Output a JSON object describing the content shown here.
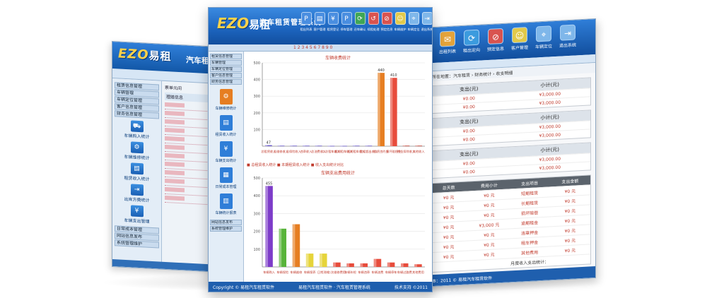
{
  "left_window": {
    "logo": "EZO",
    "logo_cn": "易租",
    "title": "汽车租赁",
    "menu": [
      "租赁信息管理",
      "车辆管理",
      "车辆定位管理",
      "客户信息管理",
      "财务信息管理"
    ],
    "icons": [
      {
        "name": "car-in-icon",
        "glyph": "⛟",
        "label": "车辆购入统计"
      },
      {
        "name": "repair-icon",
        "glyph": "⚙",
        "label": "车辆维修统计"
      },
      {
        "name": "register-icon",
        "glyph": "▤",
        "label": "租赁收入统计"
      },
      {
        "name": "out-icon",
        "glyph": "⇥",
        "label": "出库方费统计"
      },
      {
        "name": "cost-icon",
        "glyph": "¥",
        "label": "车辆支出管理"
      }
    ],
    "submenu": [
      "日常成本管理",
      "网站信息发布",
      "系统管理维护"
    ],
    "main_header": "票单元间",
    "table_header": "理赔信息"
  },
  "right_window": {
    "toolbar": [
      {
        "name": "mail-icon",
        "glyph": "✉",
        "label": "出租列表",
        "color": "#e4a33a"
      },
      {
        "name": "recycle-icon",
        "glyph": "⟳",
        "label": "租出定向",
        "color": "#3c9bde"
      },
      {
        "name": "ban-icon",
        "glyph": "⊘",
        "label": "预定信息",
        "color": "#d9534f"
      },
      {
        "name": "people-icon",
        "glyph": "☺",
        "label": "客户管理",
        "color": "#e2c94a"
      },
      {
        "name": "gps-icon",
        "glyph": "⌖",
        "label": "车辆定位",
        "color": "#7fb7ea"
      },
      {
        "name": "exit-icon",
        "glyph": "⇥",
        "label": "退出系统",
        "color": "#7fb7ea"
      }
    ],
    "crumb": "您所在地置：汽车租赁 › 财务统计 › 收支明细",
    "blocks": [
      {
        "left_header": "支出(元)",
        "right_header": "小计(元)",
        "rows": [
          [
            "¥0.00",
            "¥3,000.00"
          ],
          [
            "¥0.00",
            "¥3,000.00"
          ]
        ]
      },
      {
        "left_header": "支出(元)",
        "right_header": "小计(元)",
        "rows": [
          [
            "¥0.00",
            "¥3,000.00"
          ],
          [
            "¥0.00",
            "¥3,000.00"
          ]
        ]
      },
      {
        "left_header": "支出(元)",
        "right_header": "小计(元)",
        "rows": [
          [
            "¥0.00",
            "¥3,000.00"
          ],
          [
            "¥0.00",
            "¥3,000.00"
          ]
        ]
      }
    ],
    "table": {
      "headers": [
        "总天数",
        "费用小计",
        "支出项目",
        "支出金额"
      ],
      "rows": [
        [
          "¥0 元",
          "¥0 元",
          "短期租赁",
          "¥0 元"
        ],
        [
          "¥0 元",
          "¥0 元",
          "长期租赁",
          "¥0 元"
        ],
        [
          "¥0 元",
          "¥0 元",
          "损坏赔偿",
          "¥0 元"
        ],
        [
          "¥0 元",
          "¥3,000 元",
          "逾期租金",
          "¥0 元"
        ],
        [
          "¥0 元",
          "¥0 元",
          "违章押金",
          "¥0 元"
        ],
        [
          "¥0 元",
          "¥0 元",
          "租车押金",
          "¥0 元"
        ],
        [
          "¥0 元",
          "¥0 元",
          "其他费用",
          "¥0 元"
        ]
      ],
      "summary": "月度收入支出统计："
    },
    "footer": "版本：2011 © 易租汽车租赁软件"
  },
  "center_window": {
    "logo": "EZO",
    "logo_cn": "易租",
    "title": "汽车租赁管理系统",
    "toolbar": [
      {
        "name": "parking-icon",
        "glyph": "P",
        "label": "租出列表",
        "color": "#4a8ee0"
      },
      {
        "name": "doc-icon",
        "glyph": "▤",
        "label": "客户管理",
        "color": "#4a8ee0"
      },
      {
        "name": "pay-icon",
        "glyph": "¥",
        "label": "租赁登记",
        "color": "#4a8ee0"
      },
      {
        "name": "p-icon",
        "glyph": "P",
        "label": "停车管理",
        "color": "#4a8ee0"
      },
      {
        "name": "recycle-icon",
        "glyph": "⟳",
        "label": "还车确认",
        "color": "#3fa656"
      },
      {
        "name": "return-icon",
        "glyph": "↺",
        "label": "续租处理",
        "color": "#d9534f"
      },
      {
        "name": "ban-icon",
        "glyph": "⊘",
        "label": "预定信息",
        "color": "#d9534f"
      },
      {
        "name": "people-icon",
        "glyph": "☺",
        "label": "车辆维护",
        "color": "#e2c94a"
      },
      {
        "name": "gps-icon",
        "glyph": "⌖",
        "label": "车辆定位",
        "color": "#7fb7ea"
      },
      {
        "name": "exit-icon",
        "glyph": "⇥",
        "label": "退出系统",
        "color": "#7fb7ea"
      }
    ],
    "ticker": "1 2 3 4 5 6 7 8 9 0",
    "menu": [
      "租赁信息管理",
      "车辆管理",
      "车辆定位管理",
      "客户信息管理",
      "财务信息管理"
    ],
    "side_icons": [
      {
        "name": "repair-icon",
        "glyph": "⚙",
        "label": "车辆维修统计",
        "color": "#e67e22"
      },
      {
        "name": "register-icon",
        "glyph": "▤",
        "label": "租赁收入统计",
        "color": "#2f7ed8"
      },
      {
        "name": "cash-icon",
        "glyph": "¥",
        "label": "车辆支出统计",
        "color": "#2f7ed8"
      },
      {
        "name": "grid-icon",
        "glyph": "▦",
        "label": "日常成本管理",
        "color": "#2f7ed8"
      },
      {
        "name": "stats-icon",
        "glyph": "▥",
        "label": "车辆统计报表",
        "color": "#2f7ed8"
      }
    ],
    "submenu": [
      "网站信息发布",
      "系统管理维护"
    ],
    "legend": "■ 总租赁收入统计  ■ 本期租赁收入统计  ■ 收入支出统计对比",
    "footer_left": "Copyright © 易租汽车租赁软件",
    "footer_center": "易租汽车租赁软件 · 汽车租赁管理系统",
    "footer_right": "技术支持 ©2011"
  },
  "chart_data": [
    {
      "type": "bar",
      "title": "车辆收费统计",
      "ylim": [
        0,
        500
      ],
      "yticks": [
        100,
        200,
        300,
        400,
        500
      ],
      "categories": [
        "总租赁收入",
        "总维修收入",
        "总保险收入",
        "违章收入",
        "总油费收入",
        "二次租车收入",
        "超期租车收入",
        "短期租车收入",
        "里程超出收入",
        "租赁违约金",
        "损坏赔偿金",
        "押金扣除收入",
        "其他收入"
      ],
      "values": [
        6,
        3,
        3,
        3,
        3,
        2,
        2,
        3,
        3,
        440,
        410,
        3,
        3
      ],
      "data_labels": [
        "47",
        "",
        "",
        "",
        "",
        "",
        "",
        "",
        "",
        "440",
        "410",
        "",
        ""
      ],
      "colors": [
        "#6a5acd",
        "#6a5acd",
        "#6a5acd",
        "#6a5acd",
        "#6a5acd",
        "#6a5acd",
        "#6a5acd",
        "#6a5acd",
        "#6a5acd",
        "#e67e22",
        "#e74c3c",
        "#c0392b",
        "#c0392b"
      ]
    },
    {
      "type": "bar",
      "title": "车辆支出费用统计",
      "ylim": [
        0,
        500
      ],
      "yticks": [
        100,
        200,
        300,
        400,
        500
      ],
      "categories": [
        "车辆购入",
        "车辆保险",
        "车辆维修",
        "车辆保养",
        "日常消耗",
        "二次维修费用",
        "车辆年检",
        "车辆违章",
        "车辆油费",
        "车辆停车",
        "车辆过路费",
        "其他费用"
      ],
      "values": [
        455,
        215,
        240,
        75,
        75,
        25,
        20,
        20,
        45,
        25,
        20,
        15
      ],
      "data_labels": [
        "455",
        "",
        "",
        "",
        "",
        "",
        "",
        "",
        "",
        "",
        "",
        ""
      ],
      "colors": [
        "#7d3cc9",
        "#58b43a",
        "#e67e22",
        "#e6d43a",
        "#e6d43a",
        "#e74c3c",
        "#e74c3c",
        "#e74c3c",
        "#e74c3c",
        "#e74c3c",
        "#e74c3c",
        "#e74c3c"
      ]
    }
  ]
}
